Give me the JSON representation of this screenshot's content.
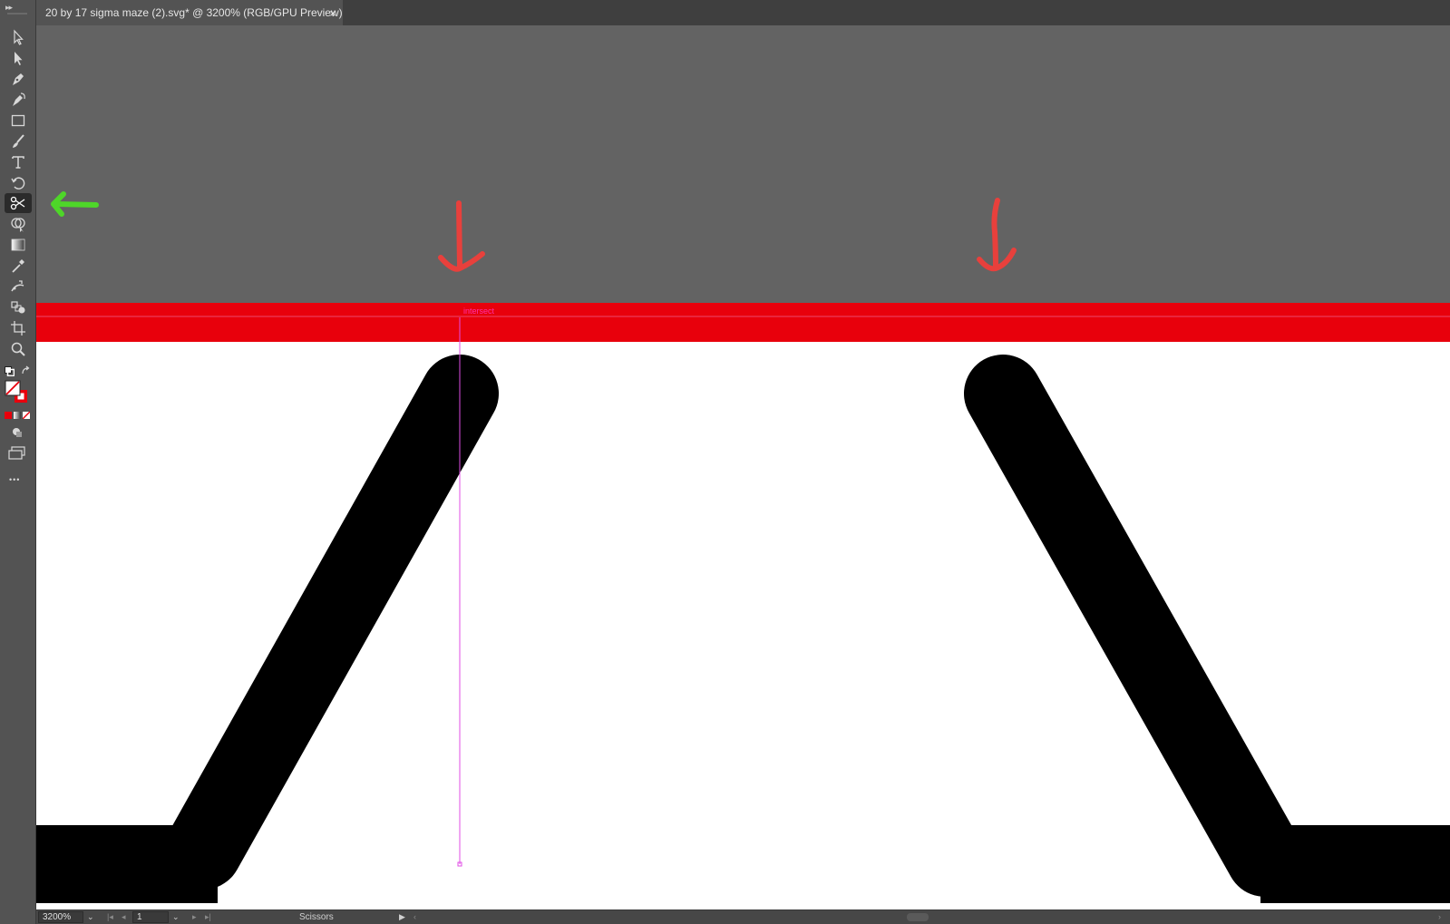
{
  "document_tab": {
    "title": "20 by 17 sigma maze (2).svg* @ 3200% (RGB/GPU Preview)",
    "close_glyph": "×"
  },
  "toolbar": {
    "tools": [
      {
        "name": "selection-tool",
        "icon": "arrow-icon"
      },
      {
        "name": "direct-selection-tool",
        "icon": "filled-arrow-icon"
      },
      {
        "name": "pen-tool",
        "icon": "pen-icon"
      },
      {
        "name": "curvature-tool",
        "icon": "curvature-pen-icon"
      },
      {
        "name": "rectangle-tool",
        "icon": "rectangle-icon"
      },
      {
        "name": "paintbrush-tool",
        "icon": "brush-icon"
      },
      {
        "name": "type-tool",
        "icon": "type-icon"
      },
      {
        "name": "rotate-tool",
        "icon": "rotate-icon"
      },
      {
        "name": "scissors-tool",
        "icon": "scissors-icon",
        "active": true
      },
      {
        "name": "shape-builder-tool",
        "icon": "shape-builder-icon"
      },
      {
        "name": "gradient-tool",
        "icon": "gradient-icon"
      },
      {
        "name": "eyedropper-tool",
        "icon": "eyedropper-icon"
      },
      {
        "name": "puppet-warp-tool",
        "icon": "puppet-warp-icon"
      },
      {
        "name": "blend-tool",
        "icon": "blend-icon"
      },
      {
        "name": "artboard-tool",
        "icon": "artboard-icon"
      },
      {
        "name": "zoom-tool",
        "icon": "magnifier-icon"
      }
    ],
    "more_glyph": "•••"
  },
  "canvas": {
    "smart_guide_label": "intersect",
    "colors": {
      "pasteboard": "#636363",
      "artboard": "#ffffff",
      "red_band": "#e8000c",
      "maze_stroke": "#000000",
      "smart_guide": "#e14ee6",
      "annotation_red": "#e8403c",
      "annotation_green": "#4ed629"
    }
  },
  "statusbar": {
    "zoom": "3200%",
    "artboard_number": "1",
    "current_tool": "Scissors"
  }
}
